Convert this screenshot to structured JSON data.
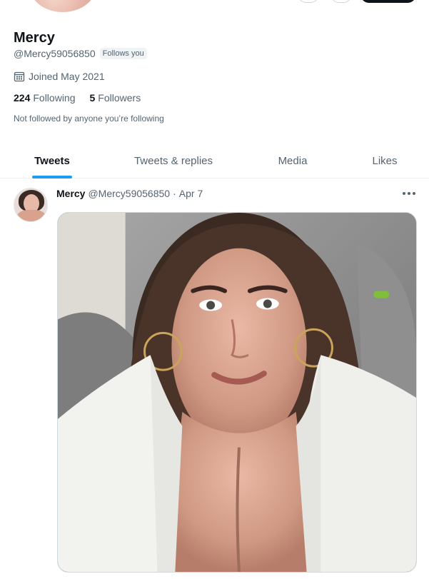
{
  "profile": {
    "name": "Mercy",
    "handle": "@Mercy59056850",
    "follows_you": "Follows you",
    "joined": "Joined May 2021",
    "following_count": "224",
    "following_label": "Following",
    "followers_count": "5",
    "followers_label": "Followers",
    "not_followed": "Not followed by anyone you’re following"
  },
  "tabs": [
    {
      "label": "Tweets",
      "active": true
    },
    {
      "label": "Tweets & replies",
      "active": false
    },
    {
      "label": "Media",
      "active": false
    },
    {
      "label": "Likes",
      "active": false
    }
  ],
  "tweet": {
    "author_name": "Mercy",
    "author_handle": "@Mercy59056850",
    "separator": "·",
    "date": "Apr 7",
    "more_icon": "more-horizontal-icon"
  },
  "colors": {
    "accent": "#1d9bf0",
    "text_primary": "#0f1419",
    "text_secondary": "#536471"
  }
}
